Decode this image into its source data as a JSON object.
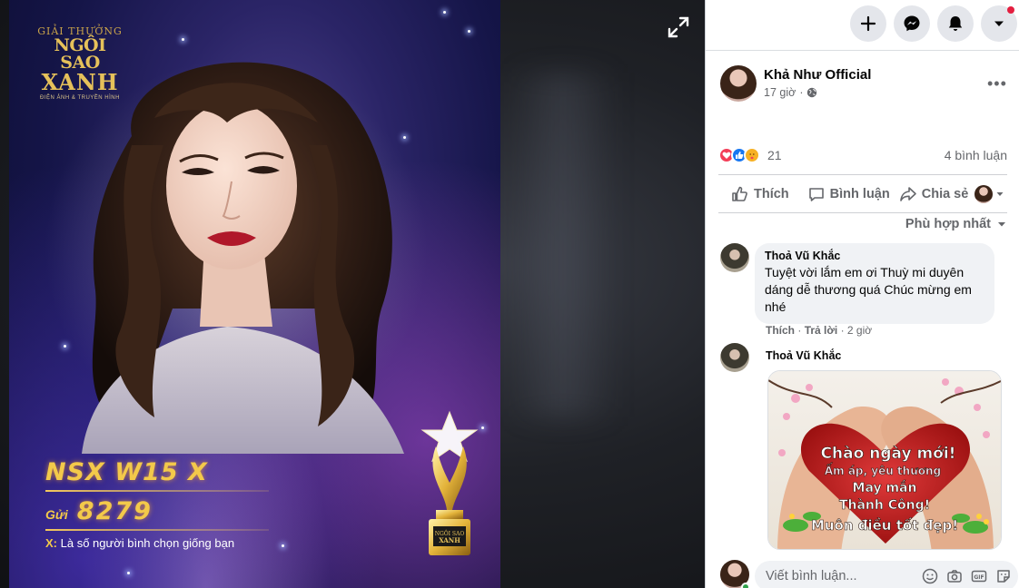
{
  "viewer": {
    "poster": {
      "logo_line1": "GIẢI THƯỞNG",
      "logo_line2": "NGÔI SAO",
      "logo_line3": "XANH",
      "logo_line4": "ĐIỆN ẢNH & TRUYỀN HÌNH",
      "vote_code": "NSX W15 X",
      "send_label": "Gửi",
      "send_number": "8279",
      "note_prefix": "X:",
      "note_text": "Là số người bình chọn giống bạn"
    },
    "expand_icon": "expand-icon"
  },
  "topbar": {
    "create_icon": "plus-icon",
    "messenger_icon": "messenger-icon",
    "notifications_icon": "bell-icon",
    "account_icon": "caret-down-icon",
    "notification_badge_color": "#e41e3f"
  },
  "post": {
    "author": "Khả Như Official",
    "time": "17 giờ",
    "privacy_icon": "globe-icon",
    "more_icon": "more-dots-icon",
    "reaction_count": "21",
    "reactions": [
      "love",
      "like",
      "care"
    ],
    "comments_count": "4 bình luận",
    "actions": {
      "like": "Thích",
      "comment": "Bình luận",
      "share": "Chia sẻ"
    },
    "sort_label": "Phù hợp nhất"
  },
  "comments": [
    {
      "author": "Thoả Vũ Khắc",
      "text": "Tuyệt vời lắm em ơi Thuỳ mi duyên dáng dễ thương quá Chúc mừng em nhé",
      "like": "Thích",
      "reply": "Trả lời",
      "time": "2 giờ"
    },
    {
      "author": "Thoả Vũ Khắc",
      "image_lines": [
        "Chào ngày mới!",
        "Ấm áp, yêu thương",
        "May mắn",
        "Thành Công!",
        "Muôn điều tốt đẹp!"
      ]
    }
  ],
  "composer": {
    "placeholder": "Viết bình luận..."
  },
  "colors": {
    "accent_blue": "#1877f2",
    "love_red": "#f33e58",
    "care_yellow": "#f7b125",
    "poster_gold": "#f3c94a"
  }
}
